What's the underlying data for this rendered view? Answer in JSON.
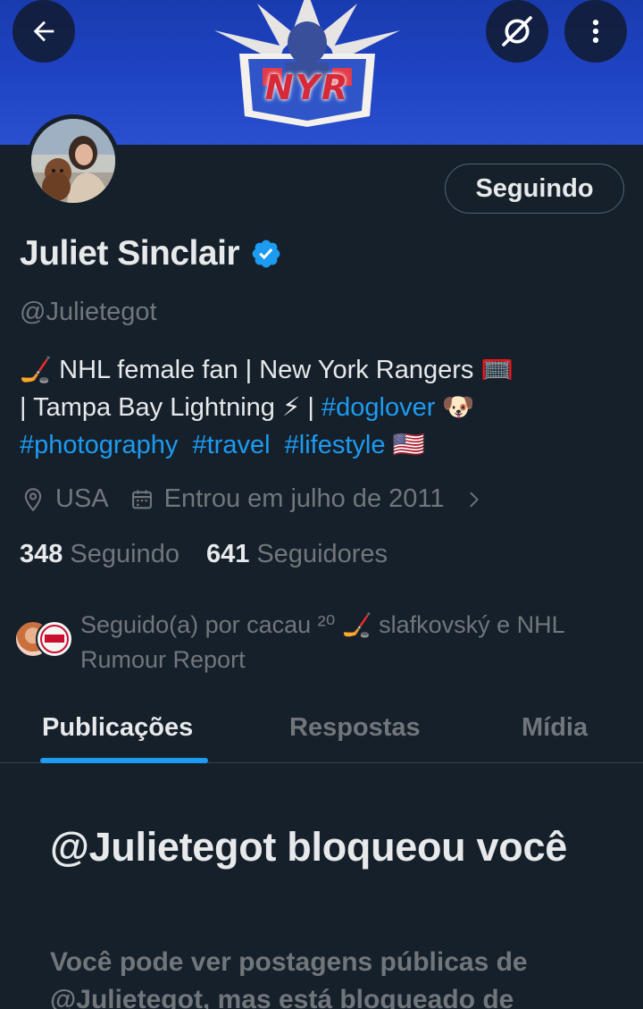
{
  "banner": {
    "logo_text": "NYR",
    "colors": {
      "background": "#1f44c4",
      "logo_red": "#d62a3a"
    }
  },
  "header": {
    "back_icon": "arrow-left-icon",
    "hide_icon": "eye-slash-icon",
    "more_icon": "more-vertical-icon"
  },
  "profile": {
    "follow_button_label": "Seguindo",
    "display_name": "Juliet Sinclair",
    "verified_icon": "verified-badge-icon",
    "handle": "@Julietegot",
    "bio": {
      "line1": "🏒 NHL female fan | New York Rangers 🥅",
      "line2_text": "| Tampa Bay Lightning ⚡ | ",
      "line2_tag": "#doglover",
      "line2_emoji": " 🐶",
      "tag1": "#photography",
      "tag2": "#travel",
      "tag3": "#lifestyle",
      "flag": " 🇺🇸"
    },
    "location": "USA",
    "joined": "Entrou em julho de 2011",
    "following_count": "348",
    "following_label": "Seguindo",
    "followers_count": "641",
    "followers_label": "Seguidores",
    "followed_by": "Seguido(a) por cacau ²⁰ 🏒 slafkovský e NHL Rumour Report"
  },
  "tabs": [
    {
      "label": "Publicações",
      "active": true
    },
    {
      "label": "Respostas",
      "active": false
    },
    {
      "label": "Mídia",
      "active": false
    }
  ],
  "blocked": {
    "title": "@Julietegot bloqueou você",
    "description": "Você pode ver postagens públicas de @Julietegot, mas está bloqueado de"
  },
  "colors": {
    "background": "#15202b",
    "accent": "#1d9bf0",
    "muted_text": "#71767b",
    "primary_text": "#e7e9ea",
    "border": "#38444d"
  }
}
